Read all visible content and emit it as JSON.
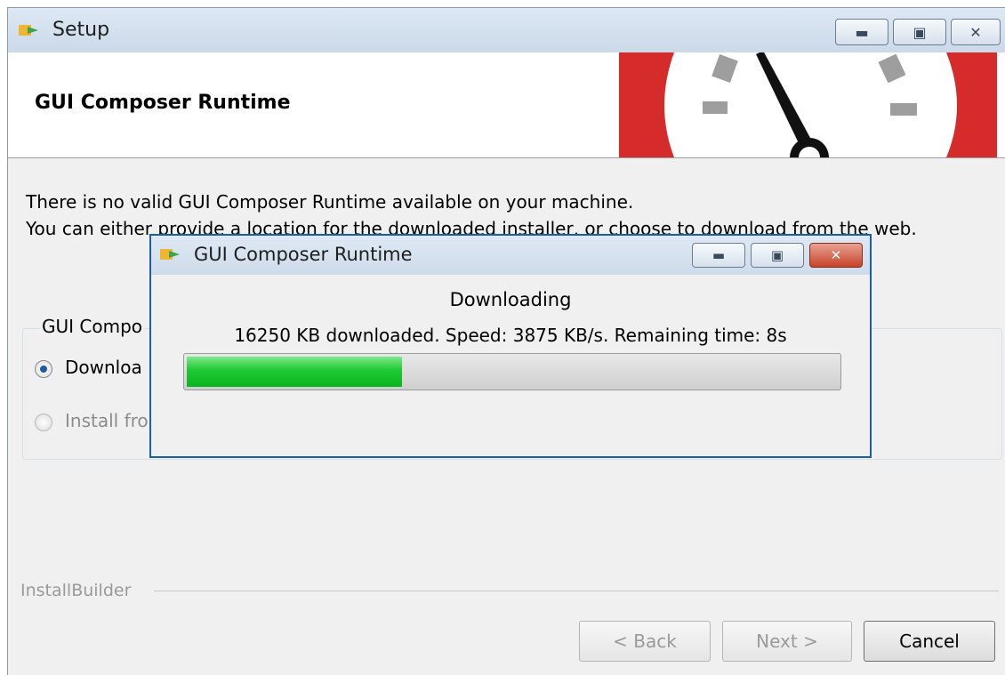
{
  "window": {
    "title": "Setup",
    "header_title": "GUI Composer Runtime",
    "message_line1": "There is no valid GUI Composer Runtime available on your machine.",
    "message_line2": "You can either provide a location for the downloaded installer, or choose to download from the web.",
    "group_label": "GUI Compo",
    "options": [
      {
        "label": "Downloa",
        "checked": true,
        "enabled": true
      },
      {
        "label": "Install fro",
        "checked": false,
        "enabled": false
      }
    ],
    "brand": "InstallBuilder",
    "buttons": {
      "back": "< Back",
      "next": "Next >",
      "cancel": "Cancel"
    }
  },
  "dialog": {
    "title": "GUI Composer Runtime",
    "status_heading": "Downloading",
    "status_detail": "16250 KB downloaded. Speed: 3875 KB/s. Remaining time:  8s",
    "progress_percent": 33
  },
  "colors": {
    "logo_red": "#d52b2b",
    "progress_green": "#1ec832",
    "dialog_border": "#1a5fa0"
  }
}
